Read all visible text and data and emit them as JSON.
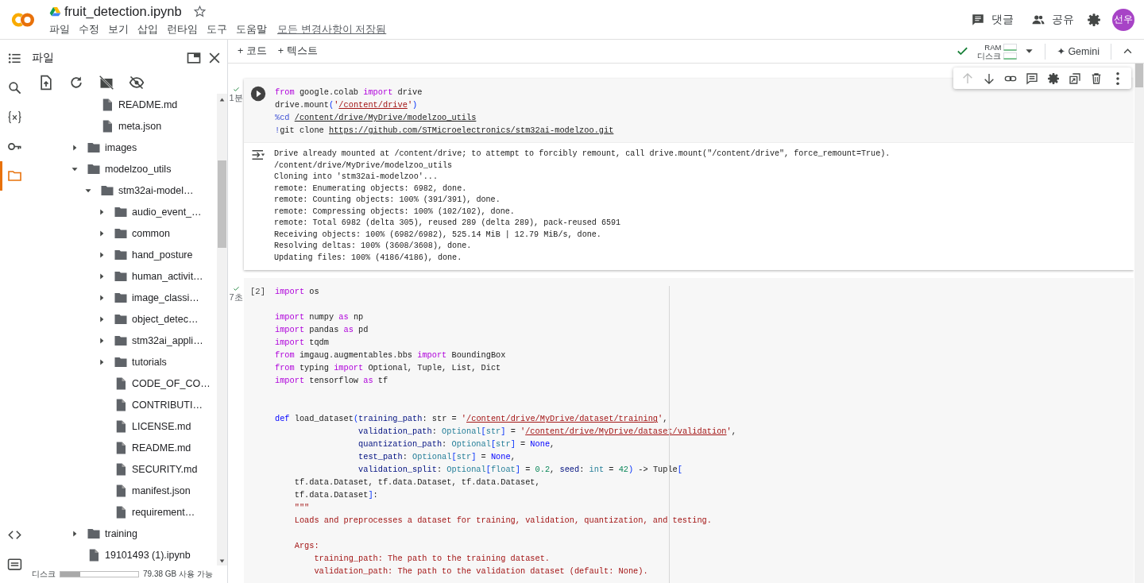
{
  "header": {
    "title": "fruit_detection.ipynb",
    "menu": [
      "파일",
      "수정",
      "보기",
      "삽입",
      "런타임",
      "도구",
      "도움말"
    ],
    "save_status": "모든 변경사항이 저장됨",
    "actions": [
      {
        "kind": "comment",
        "label": "댓글"
      },
      {
        "kind": "share",
        "label": "공유"
      },
      {
        "kind": "settings"
      }
    ],
    "avatar": "선우"
  },
  "rail": {
    "top": [
      {
        "kind": "toc",
        "selected": false
      },
      {
        "kind": "search",
        "selected": false
      },
      {
        "kind": "variables",
        "selected": false
      },
      {
        "kind": "secrets",
        "selected": false
      },
      {
        "kind": "files",
        "selected": true
      }
    ],
    "bottom": [
      {
        "kind": "snippets",
        "selected": false
      },
      {
        "kind": "terminal",
        "selected": false
      }
    ]
  },
  "files": {
    "title": "파일",
    "tools": [
      {
        "kind": "upload"
      },
      {
        "kind": "refresh"
      },
      {
        "kind": "drive_off"
      },
      {
        "kind": "hidden_off"
      }
    ],
    "tree": [
      {
        "kind": "continuation",
        "children": [
          {
            "kind": "file",
            "name": "README.md"
          },
          {
            "kind": "file",
            "name": "meta.json"
          }
        ]
      },
      {
        "kind": "folder",
        "name": "images",
        "expanded": false
      },
      {
        "kind": "folder",
        "name": "modelzoo_utils",
        "expanded": true,
        "children": [
          {
            "kind": "folder",
            "name": "stm32ai-model…",
            "expanded": true,
            "children": [
              {
                "kind": "folder",
                "name": "audio_event_…",
                "expanded": false
              },
              {
                "kind": "folder",
                "name": "common",
                "expanded": false
              },
              {
                "kind": "folder",
                "name": "hand_posture",
                "expanded": false
              },
              {
                "kind": "folder",
                "name": "human_activit…",
                "expanded": false
              },
              {
                "kind": "folder",
                "name": "image_classi…",
                "expanded": false
              },
              {
                "kind": "folder",
                "name": "object_detec…",
                "expanded": false
              },
              {
                "kind": "folder",
                "name": "stm32ai_appli…",
                "expanded": false
              },
              {
                "kind": "folder",
                "name": "tutorials",
                "expanded": false
              },
              {
                "kind": "file",
                "name": "CODE_OF_CO…"
              },
              {
                "kind": "file",
                "name": "CONTRIBUTI…"
              },
              {
                "kind": "file",
                "name": "LICENSE.md"
              },
              {
                "kind": "file",
                "name": "README.md"
              },
              {
                "kind": "file",
                "name": "SECURITY.md"
              },
              {
                "kind": "file",
                "name": "manifest.json"
              },
              {
                "kind": "file",
                "name": "requirement…"
              }
            ]
          }
        ]
      },
      {
        "kind": "folder",
        "name": "training",
        "expanded": false
      },
      {
        "kind": "file",
        "name": "19101493 (1).ipynb"
      }
    ],
    "disk": {
      "label": "디스크",
      "level": 0.26,
      "free": "79.38 GB 사용 가능"
    }
  },
  "toolbar": {
    "add": [
      "+ 코드",
      "+ 텍스트"
    ],
    "connected": true,
    "resources": [
      "RAM",
      "디스크"
    ],
    "gemini": "✦ Gemini"
  },
  "cell_toolbar": [
    {
      "kind": "up",
      "disabled": true
    },
    {
      "kind": "down",
      "disabled": false
    },
    {
      "kind": "link",
      "disabled": false
    },
    {
      "kind": "comment",
      "disabled": false
    },
    {
      "kind": "settings",
      "disabled": false
    },
    {
      "kind": "mirror",
      "disabled": false
    },
    {
      "kind": "delete",
      "disabled": false
    },
    {
      "kind": "more",
      "disabled": false
    }
  ],
  "cells": [
    {
      "done": true,
      "time": "1분",
      "focused": true,
      "run_button": true,
      "code": [
        {
          "kind": "code",
          "tokens": [
            {
              "kind": "kw",
              "text": "from"
            },
            {
              "kind": "plain",
              "text": " google.colab "
            },
            {
              "kind": "kw",
              "text": "import"
            },
            {
              "kind": "plain",
              "text": " drive"
            }
          ]
        },
        {
          "kind": "code",
          "tokens": [
            {
              "kind": "plain",
              "text": "drive.mount"
            },
            {
              "kind": "punct",
              "text": "("
            },
            {
              "kind": "str",
              "text": "'"
            },
            {
              "kind": "strlink",
              "text": "/content/drive"
            },
            {
              "kind": "str",
              "text": "'"
            },
            {
              "kind": "punct",
              "text": ")"
            }
          ]
        },
        {
          "kind": "code",
          "tokens": [
            {
              "kind": "magic",
              "text": "%cd "
            },
            {
              "kind": "link",
              "text": "/content/drive/MyDrive/modelzoo_utils"
            }
          ]
        },
        {
          "kind": "code",
          "tokens": [
            {
              "kind": "magic",
              "text": "!"
            },
            {
              "kind": "plain",
              "text": "git clone "
            },
            {
              "kind": "link",
              "text": "https://github.com/STMicroelectronics/stm32ai-modelzoo.git"
            }
          ]
        }
      ],
      "output": [
        "Drive already mounted at /content/drive; to attempt to forcibly remount, call drive.mount(\"/content/drive\", force_remount=True).",
        "/content/drive/MyDrive/modelzoo_utils",
        "Cloning into 'stm32ai-modelzoo'...",
        "remote: Enumerating objects: 6982, done.",
        "remote: Counting objects: 100% (391/391), done.",
        "remote: Compressing objects: 100% (102/102), done.",
        "remote: Total 6982 (delta 305), reused 289 (delta 289), pack-reused 6591",
        "Receiving objects: 100% (6982/6982), 525.14 MiB | 12.79 MiB/s, done.",
        "Resolving deltas: 100% (3608/3608), done.",
        "Updating files: 100% (4186/4186), done."
      ]
    },
    {
      "done": true,
      "time": "7초",
      "focused": false,
      "run_button": false,
      "count": "[2]",
      "code": [
        {
          "kind": "code",
          "tokens": [
            {
              "kind": "kw",
              "text": "import"
            },
            {
              "kind": "plain",
              "text": " os"
            }
          ]
        },
        {
          "kind": "blank"
        },
        {
          "kind": "code",
          "tokens": [
            {
              "kind": "kw",
              "text": "import"
            },
            {
              "kind": "plain",
              "text": " numpy "
            },
            {
              "kind": "kw",
              "text": "as"
            },
            {
              "kind": "plain",
              "text": " np"
            }
          ]
        },
        {
          "kind": "code",
          "tokens": [
            {
              "kind": "kw",
              "text": "import"
            },
            {
              "kind": "plain",
              "text": " pandas "
            },
            {
              "kind": "kw",
              "text": "as"
            },
            {
              "kind": "plain",
              "text": " pd"
            }
          ]
        },
        {
          "kind": "code",
          "tokens": [
            {
              "kind": "kw",
              "text": "import"
            },
            {
              "kind": "plain",
              "text": " tqdm"
            }
          ]
        },
        {
          "kind": "code",
          "tokens": [
            {
              "kind": "kw",
              "text": "from"
            },
            {
              "kind": "plain",
              "text": " imgaug.augmentables.bbs "
            },
            {
              "kind": "kw",
              "text": "import"
            },
            {
              "kind": "plain",
              "text": " BoundingBox"
            }
          ]
        },
        {
          "kind": "code",
          "tokens": [
            {
              "kind": "kw",
              "text": "from"
            },
            {
              "kind": "plain",
              "text": " typing "
            },
            {
              "kind": "kw",
              "text": "import"
            },
            {
              "kind": "plain",
              "text": " Optional, Tuple, List, Dict"
            }
          ]
        },
        {
          "kind": "code",
          "tokens": [
            {
              "kind": "kw",
              "text": "import"
            },
            {
              "kind": "plain",
              "text": " tensorflow "
            },
            {
              "kind": "kw",
              "text": "as"
            },
            {
              "kind": "plain",
              "text": " tf"
            }
          ]
        },
        {
          "kind": "blank"
        },
        {
          "kind": "blank"
        },
        {
          "kind": "code",
          "tokens": [
            {
              "kind": "def",
              "text": "def"
            },
            {
              "kind": "plain",
              "text": " load_dataset"
            },
            {
              "kind": "punct",
              "text": "("
            },
            {
              "kind": "param",
              "text": "training_path"
            },
            {
              "kind": "plain",
              "text": ": str = "
            },
            {
              "kind": "str",
              "text": "'"
            },
            {
              "kind": "strlink",
              "text": "/content/drive/MyDrive/dataset/training"
            },
            {
              "kind": "str",
              "text": "'"
            },
            {
              "kind": "plain",
              "text": ","
            }
          ]
        },
        {
          "kind": "code",
          "tokens": [
            {
              "kind": "param",
              "text": "                 validation_path"
            },
            {
              "kind": "plain",
              "text": ": "
            },
            {
              "kind": "type",
              "text": "Optional"
            },
            {
              "kind": "punct",
              "text": "["
            },
            {
              "kind": "type",
              "text": "str"
            },
            {
              "kind": "punct",
              "text": "]"
            },
            {
              "kind": "plain",
              "text": " = "
            },
            {
              "kind": "str",
              "text": "'"
            },
            {
              "kind": "strlink",
              "text": "/content/drive/MyDrive/dataset/validation"
            },
            {
              "kind": "str",
              "text": "'"
            },
            {
              "kind": "plain",
              "text": ","
            }
          ]
        },
        {
          "kind": "code",
          "tokens": [
            {
              "kind": "param",
              "text": "                 quantization_path"
            },
            {
              "kind": "plain",
              "text": ": "
            },
            {
              "kind": "type",
              "text": "Optional"
            },
            {
              "kind": "punct",
              "text": "["
            },
            {
              "kind": "type",
              "text": "str"
            },
            {
              "kind": "punct",
              "text": "]"
            },
            {
              "kind": "plain",
              "text": " = "
            },
            {
              "kind": "const",
              "text": "None"
            },
            {
              "kind": "plain",
              "text": ","
            }
          ]
        },
        {
          "kind": "code",
          "tokens": [
            {
              "kind": "param",
              "text": "                 test_path"
            },
            {
              "kind": "plain",
              "text": ": "
            },
            {
              "kind": "type",
              "text": "Optional"
            },
            {
              "kind": "punct",
              "text": "["
            },
            {
              "kind": "type",
              "text": "str"
            },
            {
              "kind": "punct",
              "text": "]"
            },
            {
              "kind": "plain",
              "text": " = "
            },
            {
              "kind": "const",
              "text": "None"
            },
            {
              "kind": "plain",
              "text": ","
            }
          ]
        },
        {
          "kind": "code",
          "tokens": [
            {
              "kind": "param",
              "text": "                 validation_split"
            },
            {
              "kind": "plain",
              "text": ": "
            },
            {
              "kind": "type",
              "text": "Optional"
            },
            {
              "kind": "punct",
              "text": "["
            },
            {
              "kind": "type",
              "text": "float"
            },
            {
              "kind": "punct",
              "text": "]"
            },
            {
              "kind": "plain",
              "text": " = "
            },
            {
              "kind": "num",
              "text": "0.2"
            },
            {
              "kind": "plain",
              "text": ", "
            },
            {
              "kind": "param",
              "text": "seed"
            },
            {
              "kind": "plain",
              "text": ": "
            },
            {
              "kind": "type",
              "text": "int"
            },
            {
              "kind": "plain",
              "text": " = "
            },
            {
              "kind": "num",
              "text": "42"
            },
            {
              "kind": "punct",
              "text": ")"
            },
            {
              "kind": "plain",
              "text": " -> Tuple"
            },
            {
              "kind": "punct",
              "text": "["
            }
          ]
        },
        {
          "kind": "code",
          "tokens": [
            {
              "kind": "plain",
              "text": "    tf.data.Dataset, tf.data.Dataset, tf.data.Dataset,"
            }
          ]
        },
        {
          "kind": "code",
          "tokens": [
            {
              "kind": "plain",
              "text": "    tf.data.Dataset"
            },
            {
              "kind": "punct",
              "text": "]"
            },
            {
              "kind": "plain",
              "text": ":"
            }
          ]
        },
        {
          "kind": "code",
          "tokens": [
            {
              "kind": "doc",
              "text": "    \"\"\""
            }
          ]
        },
        {
          "kind": "code",
          "tokens": [
            {
              "kind": "doc",
              "text": "    Loads and preprocesses a dataset for training, validation, quantization, and testing."
            }
          ]
        },
        {
          "kind": "blank"
        },
        {
          "kind": "code",
          "tokens": [
            {
              "kind": "doc",
              "text": "    Args:"
            }
          ]
        },
        {
          "kind": "code",
          "tokens": [
            {
              "kind": "doc",
              "text": "        training_path: The path to the training dataset."
            }
          ]
        },
        {
          "kind": "code",
          "tokens": [
            {
              "kind": "doc",
              "text": "        validation_path: The path to the validation dataset (default: None)."
            }
          ]
        }
      ]
    }
  ]
}
